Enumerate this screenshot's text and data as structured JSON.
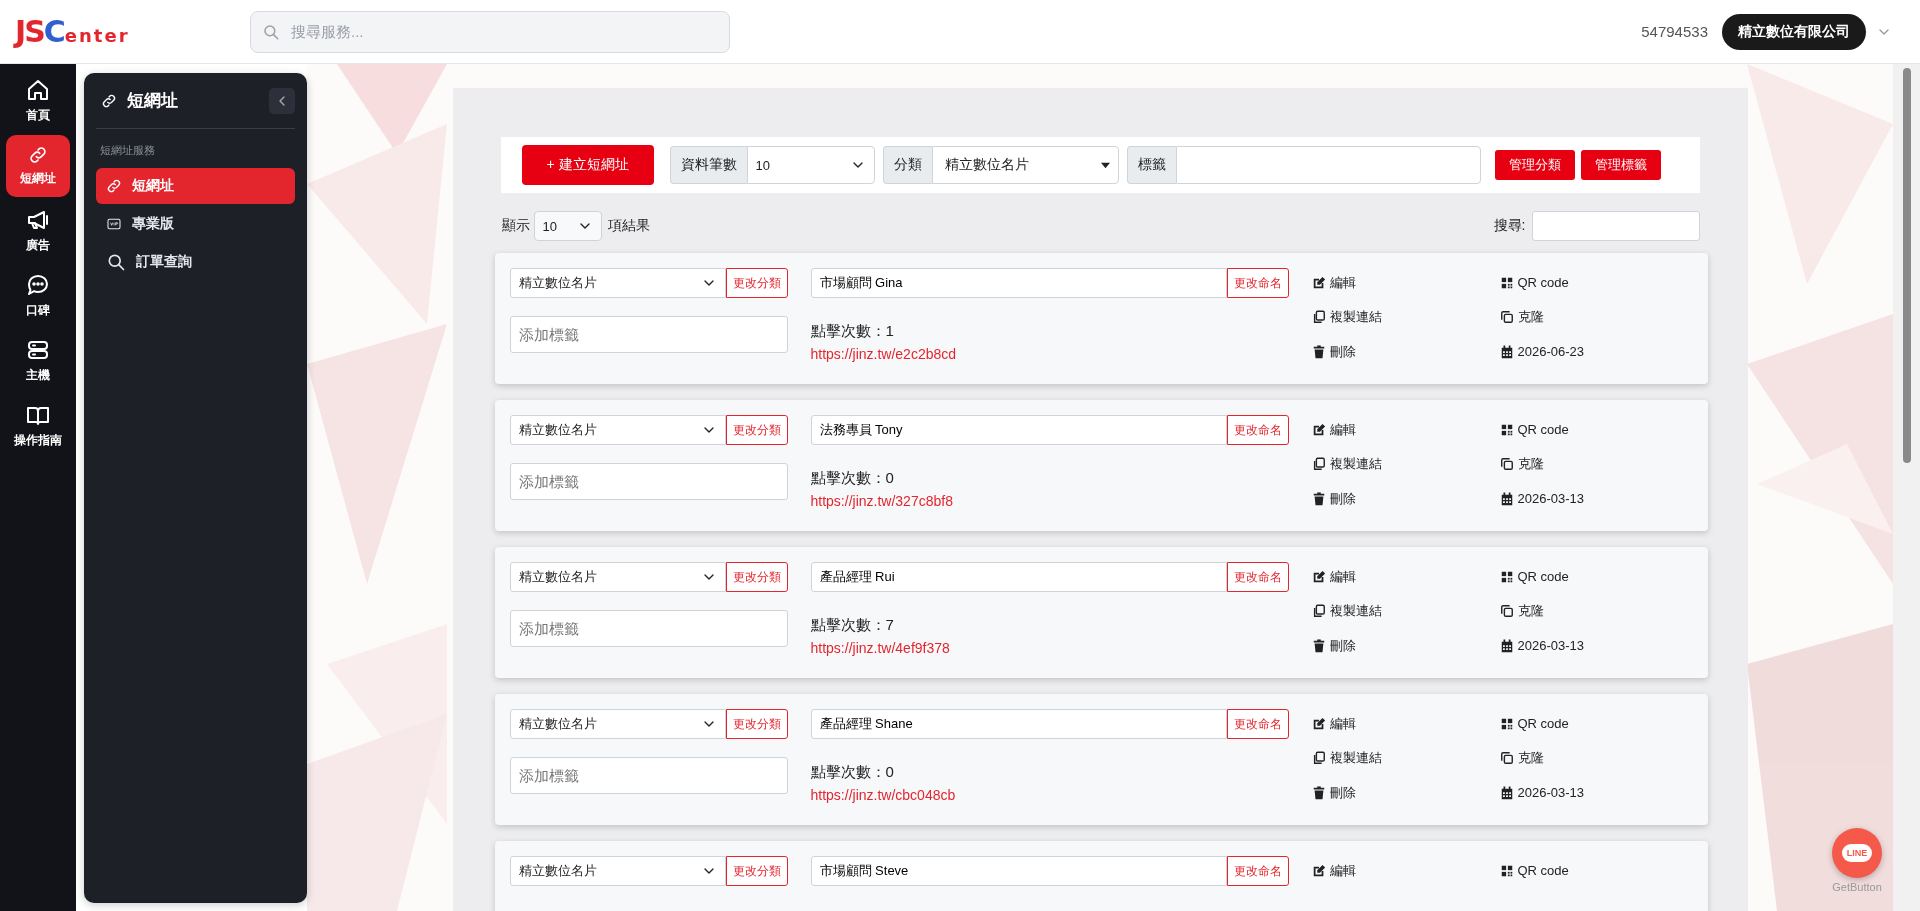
{
  "header": {
    "logo": [
      {
        "text": "JS",
        "color": "#e3262e"
      },
      {
        "text": "C",
        "color": "#2f5fd0"
      },
      {
        "text": "enter",
        "color": "#e3262e"
      }
    ],
    "search": {
      "placeholder": "搜尋服務..."
    },
    "account_id": "54794533",
    "company": "精立數位有限公司"
  },
  "rail": [
    {
      "label": "首頁",
      "kind": "home",
      "selected": false
    },
    {
      "label": "短網址",
      "kind": "link",
      "selected": true
    },
    {
      "label": "廣告",
      "kind": "megaphone",
      "selected": false
    },
    {
      "label": "口碑",
      "kind": "chat",
      "selected": false
    },
    {
      "label": "主機",
      "kind": "server",
      "selected": false
    },
    {
      "label": "操作指南",
      "kind": "book",
      "selected": false
    }
  ],
  "panel": {
    "title": "短網址",
    "section": "短網址服務",
    "items": [
      {
        "label": "短網址",
        "kind": "link",
        "selected": true
      },
      {
        "label": "專業版",
        "kind": "vip",
        "selected": false
      },
      {
        "label": "訂單查詢",
        "kind": "search",
        "selected": false
      }
    ]
  },
  "toolbar": {
    "create_button": "+ 建立短網址",
    "fields": [
      {
        "label": "資料筆數",
        "kind": "select",
        "value": "10"
      },
      {
        "label": "分類",
        "kind": "dropdown",
        "value": "精立數位名片"
      },
      {
        "label": "標籤",
        "kind": "text"
      }
    ],
    "buttons": [
      "管理分類",
      "管理標籤"
    ]
  },
  "list_controls": {
    "show_label": "顯示",
    "page_size": "10",
    "suffix": "項結果",
    "search_label": "搜尋:"
  },
  "links": [
    {
      "category": "精立數位名片",
      "category_button": "更改分類",
      "tag_placeholder": "添加標籤",
      "name": "市場顧問 Gina",
      "rename_button": "更改命名",
      "clicks": "點擊次數：1",
      "url": "https://jinz.tw/e2c2b8cd",
      "actions": [
        {
          "label": "編輯",
          "kind": "edit"
        },
        {
          "label": "QR code",
          "kind": "qr"
        },
        {
          "label": "複製連結",
          "kind": "copy"
        },
        {
          "label": "克隆",
          "kind": "clone"
        },
        {
          "label": "刪除",
          "kind": "trash"
        },
        {
          "label": "2026-06-23",
          "kind": "calendar"
        }
      ]
    },
    {
      "category": "精立數位名片",
      "category_button": "更改分類",
      "tag_placeholder": "添加標籤",
      "name": "法務專員 Tony",
      "rename_button": "更改命名",
      "clicks": "點擊次數：0",
      "url": "https://jinz.tw/327c8bf8",
      "actions": [
        {
          "label": "編輯",
          "kind": "edit"
        },
        {
          "label": "QR code",
          "kind": "qr"
        },
        {
          "label": "複製連結",
          "kind": "copy"
        },
        {
          "label": "克隆",
          "kind": "clone"
        },
        {
          "label": "刪除",
          "kind": "trash"
        },
        {
          "label": "2026-03-13",
          "kind": "calendar"
        }
      ]
    },
    {
      "category": "精立數位名片",
      "category_button": "更改分類",
      "tag_placeholder": "添加標籤",
      "name": "產品經理 Rui",
      "rename_button": "更改命名",
      "clicks": "點擊次數：7",
      "url": "https://jinz.tw/4ef9f378",
      "actions": [
        {
          "label": "編輯",
          "kind": "edit"
        },
        {
          "label": "QR code",
          "kind": "qr"
        },
        {
          "label": "複製連結",
          "kind": "copy"
        },
        {
          "label": "克隆",
          "kind": "clone"
        },
        {
          "label": "刪除",
          "kind": "trash"
        },
        {
          "label": "2026-03-13",
          "kind": "calendar"
        }
      ]
    },
    {
      "category": "精立數位名片",
      "category_button": "更改分類",
      "tag_placeholder": "添加標籤",
      "name": "產品經理 Shane",
      "rename_button": "更改命名",
      "clicks": "點擊次數：0",
      "url": "https://jinz.tw/cbc048cb",
      "actions": [
        {
          "label": "編輯",
          "kind": "edit"
        },
        {
          "label": "QR code",
          "kind": "qr"
        },
        {
          "label": "複製連結",
          "kind": "copy"
        },
        {
          "label": "克隆",
          "kind": "clone"
        },
        {
          "label": "刪除",
          "kind": "trash"
        },
        {
          "label": "2026-03-13",
          "kind": "calendar"
        }
      ]
    },
    {
      "category": "精立數位名片",
      "category_button": "更改分類",
      "name": "市場顧問 Steve",
      "rename_button": "更改命名",
      "actions": [
        {
          "label": "編輯",
          "kind": "edit"
        },
        {
          "label": "QR code",
          "kind": "qr"
        }
      ]
    }
  ],
  "chat_widget": {
    "label": "LINE",
    "credit": "GetButton"
  }
}
